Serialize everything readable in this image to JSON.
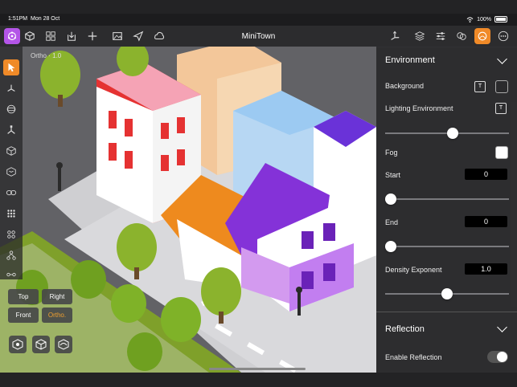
{
  "status_bar": {
    "time": "1:51PM",
    "date": "Mon 28 Oct",
    "battery": "100%"
  },
  "app": {
    "title": "MiniTown"
  },
  "toolbar": {
    "left_icons": [
      "scene-icon",
      "cube-icon",
      "grid-icon",
      "import-icon",
      "plus-icon",
      "image-icon",
      "send-icon",
      "cloud-icon"
    ],
    "right_icons": [
      "move-gizmo-icon",
      "layers-icon",
      "sliders-icon",
      "materials-icon",
      "environment-icon",
      "more-icon"
    ],
    "accent": "#b455e8",
    "active_color": "#f08a28"
  },
  "viewport": {
    "view_label": "Ortho · 1.0"
  },
  "left_tools": [
    "pointer-icon",
    "move-icon",
    "rotate-icon",
    "scale-icon",
    "cube-select-icon",
    "cube-outline-icon",
    "link-icon",
    "dots-grid-icon",
    "cluster-icon",
    "nodes-icon",
    "chain-icon"
  ],
  "camera": {
    "top": "Top",
    "right": "Right",
    "front": "Front",
    "ortho": "Ortho."
  },
  "camera_bottom_icons": [
    "focus-icon",
    "frame-icon",
    "orbit-icon"
  ],
  "panel": {
    "environment_header": "Environment",
    "background_label": "Background",
    "background_button": "T",
    "lighting_label": "Lighting Environment",
    "lighting_button": "T",
    "lighting_slider": 0.55,
    "fog_label": "Fog",
    "start_label": "Start",
    "start_value": "0",
    "start_slider": 0.0,
    "end_label": "End",
    "end_value": "0",
    "end_slider": 0.0,
    "density_label": "Density Exponent",
    "density_value": "1.0",
    "density_slider": 0.5,
    "reflection_header": "Reflection",
    "enable_reflection_label": "Enable Reflection",
    "enable_reflection_on": false
  }
}
